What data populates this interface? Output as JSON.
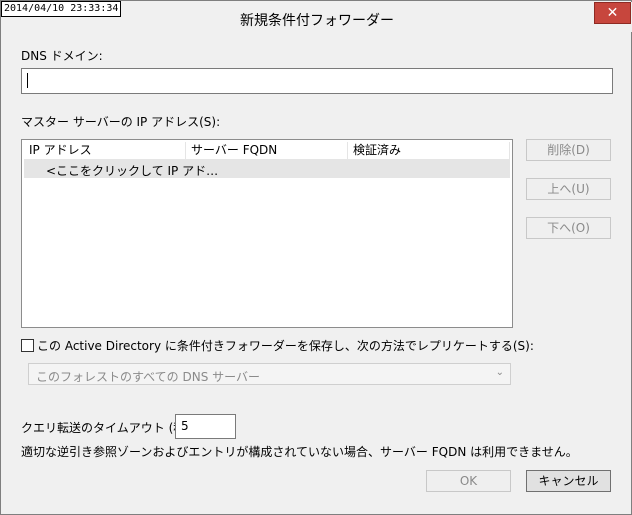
{
  "window": {
    "timestamp": "2014/04/10 23:33:34",
    "title": "新規条件付フォワーダー",
    "close_glyph": "✕"
  },
  "dns_domain": {
    "label": "DNS ドメイン:",
    "value": ""
  },
  "master_servers": {
    "label": "マスター サーバーの IP アドレス(S):",
    "columns": [
      "IP アドレス",
      "サーバー FQDN",
      "検証済み"
    ],
    "rows": [
      {
        "ip": "<ここをクリックして IP アド…",
        "fqdn": "",
        "verified": ""
      }
    ]
  },
  "side_buttons": {
    "delete": "削除(D)",
    "up": "上へ(U)",
    "down": "下へ(O)"
  },
  "replicate": {
    "checkbox_label": "この Active Directory に条件付きフォワーダーを保存し、次の方法でレプリケートする(S):",
    "checked": false,
    "scope_selected": "このフォレストのすべての DNS サーバー"
  },
  "timeout": {
    "label": "クエリ転送のタイムアウト (秒):",
    "value": "5"
  },
  "note": "適切な逆引き参照ゾーンおよびエントリが構成されていない場合、サーバー FQDN は利用できません。",
  "buttons": {
    "ok": "OK",
    "cancel": "キャンセル"
  },
  "icons": {
    "close": "close-icon",
    "dropdown": "chevron-down-icon"
  }
}
